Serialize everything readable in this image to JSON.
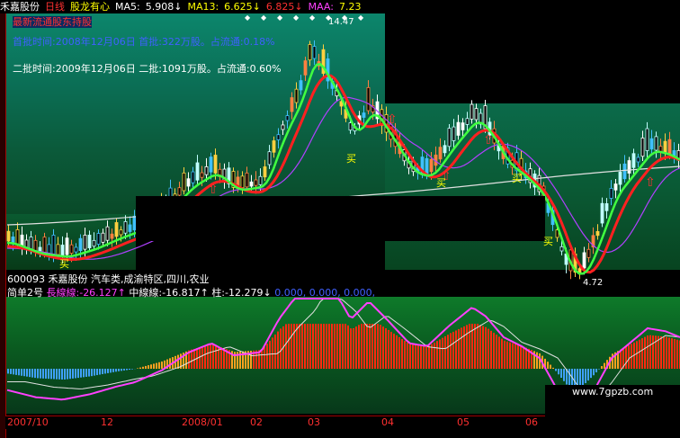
{
  "header": {
    "stock_name": "禾嘉股份",
    "period": "日线",
    "brand": "股龙有心",
    "ma5_label": "MA5:",
    "ma5_value": "5.908↓",
    "ma13_label": "MA13:",
    "ma13_value": "6.625↓",
    "extra_value": "6.825↓",
    "maa_label": "MAA:",
    "maa_value": "7.23"
  },
  "annotations": {
    "red_line": "最新流通股东持股",
    "first_batch": "首批时间:2008年12月06日 首批:322万股。占流通:0.18%",
    "second_batch": "二批时间:2009年12月06日 二批:1091万股。占流通:0.60%",
    "peak_value": "14.47",
    "low_value": "4.72",
    "buy_signal": "买"
  },
  "stock_info": {
    "code": "600093",
    "name": "禾嘉股份",
    "sectors": "汽车类,成渝特区,四川,农业"
  },
  "indicator": {
    "name": "简单2号",
    "long_label": "長線線:",
    "long_value": "-26.127↑",
    "mid_label": "中線線:",
    "mid_value": "-16.817↑",
    "bar_label": "柱:",
    "bar_value": "-12.279↓",
    "extra": "0.000, 0.000, 0.000,"
  },
  "date_axis": [
    "2007/10",
    "12",
    "2008/01",
    "02",
    "03",
    "04",
    "05",
    "06"
  ],
  "watermark": "www.7gpzb.com",
  "colors": {
    "red": "#ff3030",
    "yellow": "#ffff00",
    "magenta": "#ff40ff",
    "blue": "#4060ff",
    "green_line": "#40ff40"
  }
}
